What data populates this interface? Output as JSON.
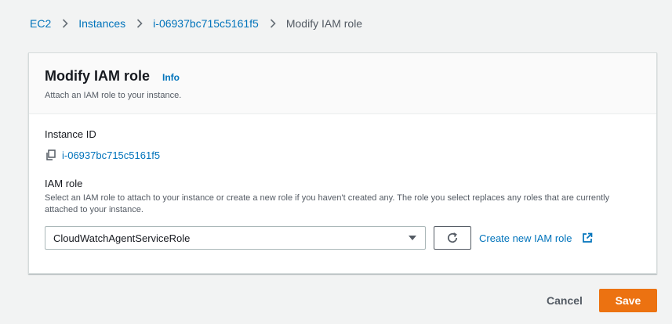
{
  "breadcrumb": {
    "items": [
      "EC2",
      "Instances",
      "i-06937bc715c5161f5"
    ],
    "current": "Modify IAM role"
  },
  "panel": {
    "title": "Modify IAM role",
    "info_label": "Info",
    "description": "Attach an IAM role to your instance."
  },
  "instance": {
    "label": "Instance ID",
    "id": "i-06937bc715c5161f5"
  },
  "iam": {
    "label": "IAM role",
    "description": "Select an IAM role to attach to your instance or create a new role if you haven't created any. The role you select replaces any roles that are currently attached to your instance.",
    "selected_role": "CloudWatchAgentServiceRole",
    "create_link": "Create new IAM role"
  },
  "footer": {
    "cancel_label": "Cancel",
    "save_label": "Save"
  },
  "colors": {
    "link": "#0073bb",
    "primary": "#ec7211",
    "background": "#f2f3f3"
  },
  "icons": [
    "chevron-right-icon",
    "copy-icon",
    "caret-down-icon",
    "refresh-icon",
    "external-link-icon"
  ]
}
